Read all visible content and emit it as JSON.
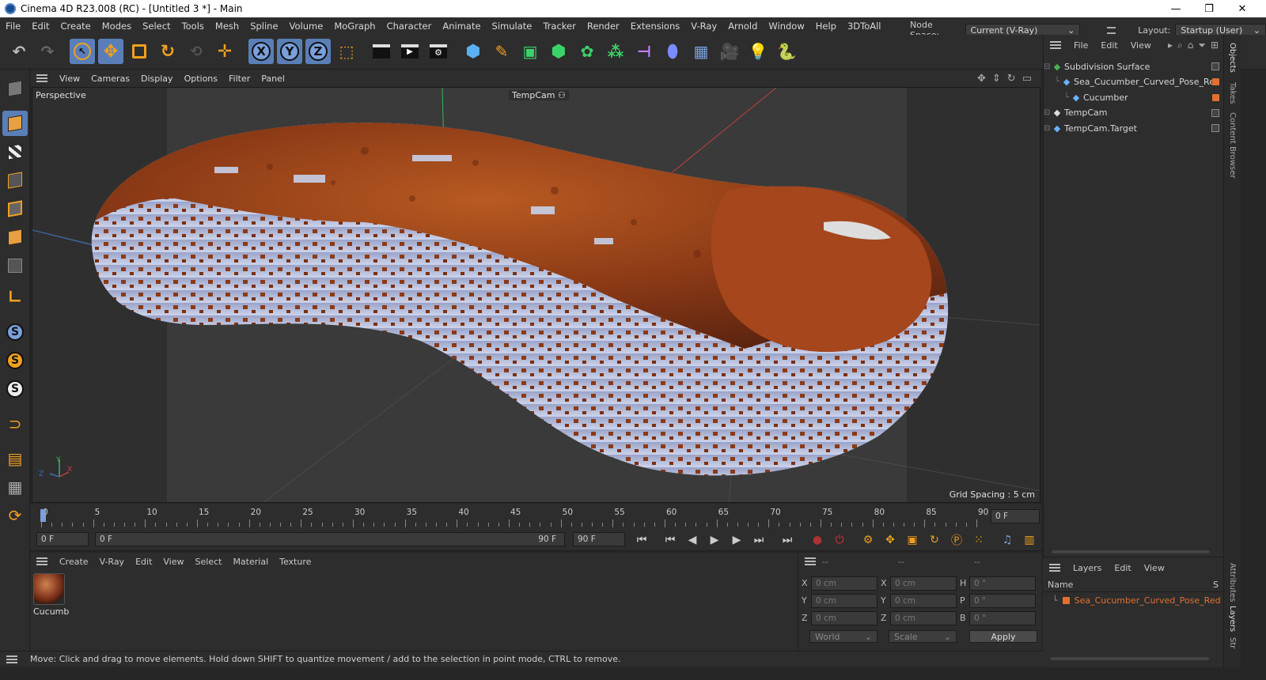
{
  "window": {
    "title": "Cinema 4D R23.008 (RC) - [Untitled 3 *] - Main",
    "controls": [
      "—",
      "❐",
      "✕"
    ]
  },
  "menubar": {
    "items": [
      "File",
      "Edit",
      "Create",
      "Modes",
      "Select",
      "Tools",
      "Mesh",
      "Spline",
      "Volume",
      "MoGraph",
      "Character",
      "Animate",
      "Simulate",
      "Tracker",
      "Render",
      "Extensions",
      "V-Ray",
      "Arnold",
      "Window",
      "Help",
      "3DToAll"
    ],
    "node_space_label": "Node Space:",
    "node_space_value": "Current (V-Ray)",
    "layout_label": "Layout:",
    "layout_value": "Startup (User)"
  },
  "toolbar": {
    "axis_x": "X",
    "axis_y": "Y",
    "axis_z": "Z"
  },
  "viewport": {
    "menu": [
      "View",
      "Cameras",
      "Display",
      "Options",
      "Filter",
      "Panel"
    ],
    "view_name": "Perspective",
    "camera_label": "TempCam",
    "grid_spacing": "Grid Spacing : 5 cm",
    "axis_y": "Y",
    "axis_x": "X",
    "axis_z": "Z"
  },
  "timeline": {
    "ticks": [
      "0",
      "5",
      "10",
      "15",
      "20",
      "25",
      "30",
      "35",
      "40",
      "45",
      "50",
      "55",
      "60",
      "65",
      "70",
      "75",
      "80",
      "85",
      "90"
    ],
    "current_frame": "0 F"
  },
  "playbar": {
    "start_frame": "0 F",
    "range_start": "0 F",
    "range_end": "90 F",
    "end_frame": "90 F"
  },
  "materials": {
    "menu": [
      "Create",
      "V-Ray",
      "Edit",
      "View",
      "Select",
      "Material",
      "Texture"
    ],
    "items": [
      {
        "name": "Cucumb"
      }
    ]
  },
  "coordinates": {
    "header": [
      "--",
      "--",
      "--"
    ],
    "rows": [
      {
        "a": "X",
        "av": "0 cm",
        "b": "X",
        "bv": "0 cm",
        "c": "H",
        "cv": "0 °"
      },
      {
        "a": "Y",
        "av": "0 cm",
        "b": "Y",
        "bv": "0 cm",
        "c": "P",
        "cv": "0 °"
      },
      {
        "a": "Z",
        "av": "0 cm",
        "b": "Z",
        "bv": "0 cm",
        "c": "B",
        "cv": "0 °"
      }
    ],
    "space": "World",
    "mode": "Scale",
    "apply_label": "Apply"
  },
  "objects": {
    "menu": [
      "File",
      "Edit",
      "View"
    ],
    "items": [
      {
        "label": "Subdivision Surface",
        "indent": 0,
        "color": "#4caf50",
        "tag": "check"
      },
      {
        "label": "Sea_Cucumber_Curved_Pose_Red",
        "indent": 1,
        "color": "#6ab0ff",
        "tag": "orange"
      },
      {
        "label": "Cucumber",
        "indent": 2,
        "color": "#6ab0ff",
        "tag": "orange"
      },
      {
        "label": "TempCam",
        "indent": 0,
        "color": "#dddddd",
        "tag": "check"
      },
      {
        "label": "TempCam.Target",
        "indent": 0,
        "color": "#6ab0ff",
        "tag": "check"
      }
    ]
  },
  "layers": {
    "menu": [
      "Layers",
      "Edit",
      "View"
    ],
    "col_name": "Name",
    "col_s": "S",
    "items": [
      {
        "label": "Sea_Cucumber_Curved_Pose_Red",
        "color": "#e07030"
      }
    ]
  },
  "sidetabs": [
    "Objects",
    "Takes",
    "Content Browser",
    "Attributes",
    "Layers",
    "Str"
  ],
  "status": {
    "text": "Move: Click and drag to move elements. Hold down SHIFT to quantize movement / add to the selection in point mode, CTRL to remove."
  },
  "colors": {
    "accent": "#5a7fb8",
    "panel": "#2d2d2d",
    "viewport": "#3a3a3a",
    "object_orange": "#e07030"
  }
}
